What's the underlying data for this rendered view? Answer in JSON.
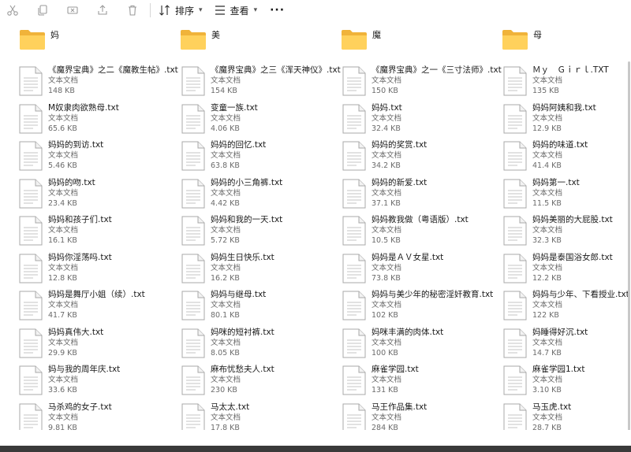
{
  "toolbar": {
    "sort_label": "排序",
    "view_label": "查看",
    "more_label": "···"
  },
  "folders": [
    {
      "name": "妈"
    },
    {
      "name": "美"
    },
    {
      "name": "魔"
    },
    {
      "name": "母"
    }
  ],
  "columns": [
    [
      {
        "name": "《魔界宝典》之二《魔教生帖》.txt",
        "type": "文本文档",
        "size": "148 KB"
      },
      {
        "name": "M奴隶肉欲熟母.txt",
        "type": "文本文档",
        "size": "65.6 KB"
      },
      {
        "name": "妈妈的到访.txt",
        "type": "文本文档",
        "size": "5.46 KB"
      },
      {
        "name": "妈妈的吻.txt",
        "type": "文本文档",
        "size": "23.4 KB"
      },
      {
        "name": "妈妈和孩子们.txt",
        "type": "文本文档",
        "size": "16.1 KB"
      },
      {
        "name": "妈妈你淫荡吗.txt",
        "type": "文本文档",
        "size": "12.8 KB"
      },
      {
        "name": "妈妈是舞厅小姐（续）.txt",
        "type": "文本文档",
        "size": "41.7 KB"
      },
      {
        "name": "妈妈真伟大.txt",
        "type": "文本文档",
        "size": "29.9 KB"
      },
      {
        "name": "妈与我的周年庆.txt",
        "type": "文本文档",
        "size": "33.6 KB"
      },
      {
        "name": "马杀鸡的女子.txt",
        "type": "文本文档",
        "size": "9.81 KB"
      }
    ],
    [
      {
        "name": "《魔界宝典》之三《浑天神仪》.txt",
        "type": "文本文档",
        "size": "154 KB"
      },
      {
        "name": "变童一族.txt",
        "type": "文本文档",
        "size": "4.06 KB"
      },
      {
        "name": "妈妈的回忆.txt",
        "type": "文本文档",
        "size": "63.8 KB"
      },
      {
        "name": "妈妈的小三角裤.txt",
        "type": "文本文档",
        "size": "4.42 KB"
      },
      {
        "name": "妈妈和我的一天.txt",
        "type": "文本文档",
        "size": "5.72 KB"
      },
      {
        "name": "妈妈生日快乐.txt",
        "type": "文本文档",
        "size": "16.2 KB"
      },
      {
        "name": "妈妈与继母.txt",
        "type": "文本文档",
        "size": "80.1 KB"
      },
      {
        "name": "妈咪的短衬裤.txt",
        "type": "文本文档",
        "size": "8.05 KB"
      },
      {
        "name": "麻布忧愁夫人.txt",
        "type": "文本文档",
        "size": "230 KB"
      },
      {
        "name": "马太太.txt",
        "type": "文本文档",
        "size": "17.8 KB"
      }
    ],
    [
      {
        "name": "《魔界宝典》之一《三寸法师》.txt",
        "type": "文本文档",
        "size": "150 KB"
      },
      {
        "name": "妈妈.txt",
        "type": "文本文档",
        "size": "32.4 KB"
      },
      {
        "name": "妈妈的奖赏.txt",
        "type": "文本文档",
        "size": "34.2 KB"
      },
      {
        "name": "妈妈的新爱.txt",
        "type": "文本文档",
        "size": "37.1 KB"
      },
      {
        "name": "妈妈教我做（粤语版）.txt",
        "type": "文本文档",
        "size": "10.5 KB"
      },
      {
        "name": "妈妈是ＡＶ女星.txt",
        "type": "文本文档",
        "size": "73.8 KB"
      },
      {
        "name": "妈妈与美少年的秘密淫奸教育.txt",
        "type": "文本文档",
        "size": "102 KB"
      },
      {
        "name": "妈咪丰满的肉体.txt",
        "type": "文本文档",
        "size": "100 KB"
      },
      {
        "name": "麻雀学园.txt",
        "type": "文本文档",
        "size": "131 KB"
      },
      {
        "name": "马王作品集.txt",
        "type": "文本文档",
        "size": "284 KB"
      }
    ],
    [
      {
        "name": "Ｍｙ　Ｇｉｒｌ.TXT",
        "type": "文本文档",
        "size": "135 KB"
      },
      {
        "name": "妈妈阿姨和我.txt",
        "type": "文本文档",
        "size": "12.9 KB"
      },
      {
        "name": "妈妈的味道.txt",
        "type": "文本文档",
        "size": "41.4 KB"
      },
      {
        "name": "妈妈第一.txt",
        "type": "文本文档",
        "size": "11.5 KB"
      },
      {
        "name": "妈妈美丽的大屁股.txt",
        "type": "文本文档",
        "size": "32.3 KB"
      },
      {
        "name": "妈妈是泰国浴女郎.txt",
        "type": "文本文档",
        "size": "12.2 KB"
      },
      {
        "name": "妈妈与少年、下看授业.txt",
        "type": "文本文档",
        "size": "122 KB"
      },
      {
        "name": "妈睡得好沉.txt",
        "type": "文本文档",
        "size": "14.7 KB"
      },
      {
        "name": "麻雀学园1.txt",
        "type": "文本文档",
        "size": "3.10 KB"
      },
      {
        "name": "马玉虎.txt",
        "type": "文本文档",
        "size": "28.7 KB"
      }
    ]
  ]
}
